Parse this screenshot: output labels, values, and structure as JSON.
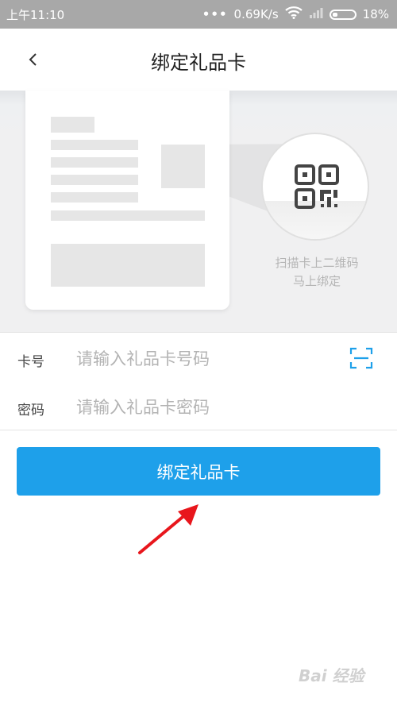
{
  "status_bar": {
    "time": "上午11:10",
    "network_speed": "0.69K/s",
    "battery": "18%"
  },
  "nav": {
    "title": "绑定礼品卡",
    "back_icon": "chevron-left-icon"
  },
  "illustration": {
    "tip_line1": "扫描卡上二维码",
    "tip_line2": "马上绑定"
  },
  "form": {
    "card_number_label": "卡号",
    "card_number_placeholder": "请输入礼品卡号码",
    "card_number_value": "",
    "password_label": "密码",
    "password_placeholder": "请输入礼品卡密码",
    "password_value": "",
    "scan_icon": "scan-frame-icon"
  },
  "submit": {
    "label": "绑定礼品卡"
  },
  "watermark": "Bai 经验",
  "colors": {
    "accent": "#1ea0ea",
    "status_bar": "#a8a8a8",
    "annotation_arrow": "#e8161c"
  }
}
